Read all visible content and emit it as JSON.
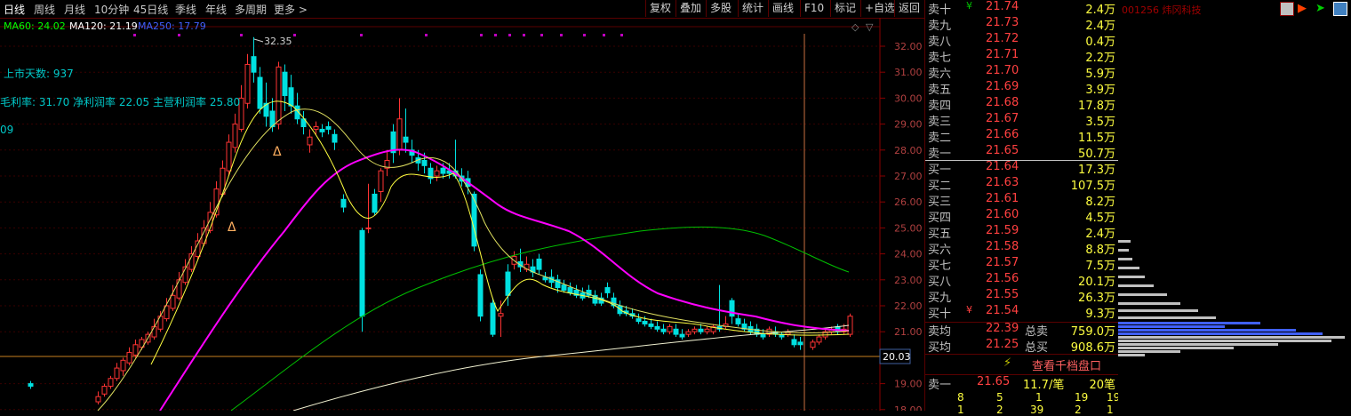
{
  "periods": [
    "日线",
    "周线",
    "月线",
    "10分钟",
    "45日线",
    "季线",
    "年线",
    "多周期",
    "更多 >"
  ],
  "tools": [
    "复权",
    "叠加",
    "多股",
    "统计",
    "画线",
    "F10",
    "标记",
    "+自选",
    "返回"
  ],
  "ma": {
    "ma60": "MA60: 24.02",
    "ma120": "MA120: 21.19",
    "ma250": "MA250: 17.79"
  },
  "info": {
    "days": "上市天数: 937",
    "ratios": "毛利率: 31.70 净利润率 22.05 主营利润率 25.80",
    "extra": "09"
  },
  "high_label": "32.35",
  "axis": [
    "32.00",
    "31.00",
    "30.00",
    "29.00",
    "28.00",
    "27.00",
    "26.00",
    "25.00",
    "24.00",
    "23.00",
    "22.00",
    "21.00",
    "20.03",
    "19.00",
    "18.00"
  ],
  "current_price": "20.03",
  "order_book": [
    {
      "label": "卖十",
      "flag": "¥",
      "price": "21.74",
      "vol": "2.4万"
    },
    {
      "label": "卖九",
      "price": "21.73",
      "vol": "2.4万"
    },
    {
      "label": "卖八",
      "price": "21.72",
      "vol": "0.4万"
    },
    {
      "label": "卖七",
      "price": "21.71",
      "vol": "2.2万"
    },
    {
      "label": "卖六",
      "price": "21.70",
      "vol": "5.9万"
    },
    {
      "label": "卖五",
      "price": "21.69",
      "vol": "3.9万"
    },
    {
      "label": "卖四",
      "price": "21.68",
      "vol": "17.8万"
    },
    {
      "label": "卖三",
      "price": "21.67",
      "vol": "3.5万"
    },
    {
      "label": "卖二",
      "price": "21.66",
      "vol": "11.5万"
    },
    {
      "label": "卖一",
      "price": "21.65",
      "vol": "50.7万"
    },
    {
      "label": "买一",
      "price": "21.64",
      "vol": "17.3万"
    },
    {
      "label": "买二",
      "price": "21.63",
      "vol": "107.5万"
    },
    {
      "label": "买三",
      "price": "21.61",
      "vol": "8.2万"
    },
    {
      "label": "买四",
      "price": "21.60",
      "vol": "4.5万"
    },
    {
      "label": "买五",
      "price": "21.59",
      "vol": "2.4万"
    },
    {
      "label": "买六",
      "price": "21.58",
      "vol": "8.8万"
    },
    {
      "label": "买七",
      "price": "21.57",
      "vol": "7.5万"
    },
    {
      "label": "买八",
      "price": "21.56",
      "vol": "20.1万"
    },
    {
      "label": "买九",
      "price": "21.55",
      "vol": "26.3万"
    },
    {
      "label": "买十",
      "flag": "¥",
      "price": "21.54",
      "vol": "9.3万"
    }
  ],
  "avg": [
    {
      "label": "卖均",
      "price": "22.39",
      "kind": "总卖",
      "vol": "759.0万"
    },
    {
      "label": "买均",
      "price": "21.25",
      "kind": "总买",
      "vol": "908.6万"
    }
  ],
  "depth_btn": "查看千档盘口",
  "last_trade": {
    "label": "卖一",
    "price": "21.65",
    "size": "11.7/笔",
    "count": "20笔"
  },
  "queue_row1": [
    "8",
    "5",
    "1",
    "19",
    "19"
  ],
  "queue_row2": [
    "1",
    "2",
    "39",
    "2",
    "1"
  ],
  "stock_title": "001256 炜冈科技",
  "colors": {
    "ma_short": "#ffff80",
    "ma_mid": "#ff00ff",
    "ma_long": "#00c000",
    "up": "#ff3333",
    "down": "#00e0e0"
  }
}
